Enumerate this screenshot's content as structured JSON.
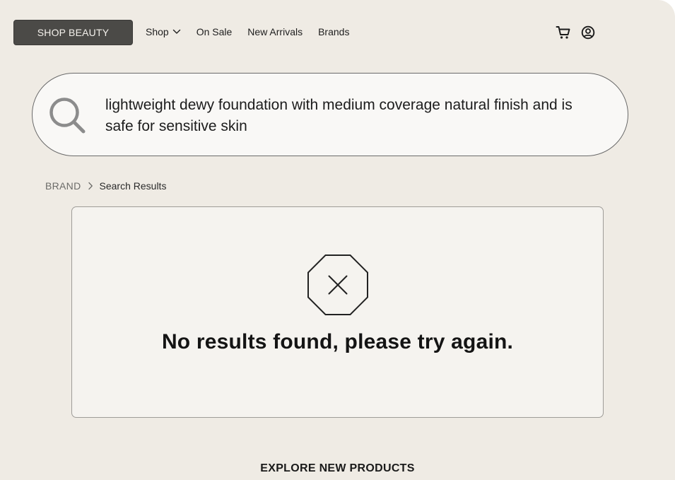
{
  "header": {
    "logo_label": "SHOP BEAUTY",
    "nav": [
      {
        "label": "Shop",
        "has_dropdown": true
      },
      {
        "label": "On Sale"
      },
      {
        "label": "New Arrivals"
      },
      {
        "label": "Brands"
      }
    ],
    "icons": [
      "cart-icon",
      "account-icon"
    ]
  },
  "search": {
    "query": "lightweight dewy foundation with medium coverage natural finish and is safe for sensitive skin",
    "icon": "search-icon"
  },
  "breadcrumb": {
    "root": "BRAND",
    "current": "Search Results"
  },
  "results": {
    "icon": "no-results-octagon-x-icon",
    "message": "No results found, please try again."
  },
  "explore": {
    "heading": "EXPLORE NEW PRODUCTS"
  },
  "colors": {
    "page_background": "#efebe4",
    "logo_background": "#4b4a47",
    "card_background": "#f5f3ef",
    "search_background": "#f9f8f6"
  }
}
